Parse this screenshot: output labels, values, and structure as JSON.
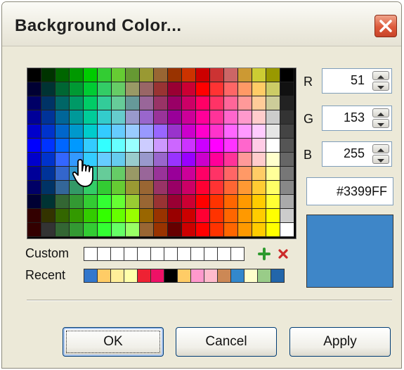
{
  "window": {
    "title": "Background Color...",
    "close_icon": "close-icon"
  },
  "palette": {
    "rows": [
      [
        "#000000",
        "#003300",
        "#006600",
        "#009900",
        "#00cc00",
        "#33cc33",
        "#66cc33",
        "#669933",
        "#999933",
        "#996633",
        "#993300",
        "#cc3300",
        "#cc0000",
        "#cc3333",
        "#cc6666",
        "#cc9933",
        "#cccc33",
        "#999900",
        "#000000"
      ],
      [
        "#000033",
        "#003333",
        "#006633",
        "#009933",
        "#00cc33",
        "#33cc66",
        "#66cc66",
        "#999966",
        "#996666",
        "#993333",
        "#990033",
        "#cc0033",
        "#ff0000",
        "#ff3333",
        "#ff6666",
        "#ff9966",
        "#ffcc66",
        "#cccc66",
        "#111111"
      ],
      [
        "#000066",
        "#003366",
        "#006666",
        "#009966",
        "#00cc66",
        "#33cc99",
        "#66cc99",
        "#669999",
        "#996699",
        "#993366",
        "#990066",
        "#cc0066",
        "#ff0066",
        "#ff3366",
        "#ff6699",
        "#ff9999",
        "#ffcc99",
        "#cccc99",
        "#222222"
      ],
      [
        "#000099",
        "#003399",
        "#006699",
        "#009999",
        "#00cc99",
        "#33cccc",
        "#66cccc",
        "#9999cc",
        "#9966cc",
        "#993399",
        "#990099",
        "#cc0099",
        "#ff0099",
        "#ff3399",
        "#ff66cc",
        "#ff99cc",
        "#ffcccc",
        "#cccccc",
        "#333333"
      ],
      [
        "#0000cc",
        "#0033cc",
        "#0066cc",
        "#0099cc",
        "#00cccc",
        "#33ccff",
        "#66ccff",
        "#99ccff",
        "#9999ff",
        "#9966ff",
        "#9933cc",
        "#cc00cc",
        "#ff00cc",
        "#ff33cc",
        "#ff66ff",
        "#ff99ff",
        "#ffccff",
        "#e6e6e6",
        "#444444"
      ],
      [
        "#0000ff",
        "#0033ff",
        "#0066ff",
        "#0099ff",
        "#33ccff",
        "#33ffff",
        "#66ffff",
        "#99ffff",
        "#ccccff",
        "#cc99ff",
        "#cc66ff",
        "#cc33ff",
        "#cc00ff",
        "#ff00ff",
        "#ff33ff",
        "#ff66cc",
        "#ffcce6",
        "#ffffff",
        "#555555"
      ],
      [
        "#0000cc",
        "#0033cc",
        "#3366ff",
        "#3399ff",
        "#33ccff",
        "#66ccff",
        "#66ccee",
        "#99cccc",
        "#9999cc",
        "#9966cc",
        "#9933ff",
        "#9900ff",
        "#cc00cc",
        "#ff0099",
        "#ff3399",
        "#ff9999",
        "#ffcccc",
        "#ffffcc",
        "#666666"
      ],
      [
        "#000099",
        "#003399",
        "#3366cc",
        "#3399cc",
        "#33cc99",
        "#66cc99",
        "#66cc66",
        "#999966",
        "#996699",
        "#993399",
        "#990099",
        "#cc0099",
        "#ff0066",
        "#ff3366",
        "#ff6666",
        "#ff9966",
        "#ffcc66",
        "#ffff99",
        "#777777"
      ],
      [
        "#000066",
        "#003366",
        "#336699",
        "#339966",
        "#33cc66",
        "#33cc33",
        "#66cc33",
        "#999933",
        "#996633",
        "#993366",
        "#990066",
        "#cc0066",
        "#ff0033",
        "#ff3333",
        "#ff6633",
        "#ff9933",
        "#ffcc33",
        "#ffff66",
        "#888888"
      ],
      [
        "#000033",
        "#003333",
        "#336633",
        "#339933",
        "#33cc33",
        "#33ff33",
        "#66ff33",
        "#99cc33",
        "#996633",
        "#993333",
        "#990033",
        "#cc0033",
        "#ff0000",
        "#ff3300",
        "#ff6600",
        "#ff9900",
        "#ffcc00",
        "#ffff33",
        "#aaaaaa"
      ],
      [
        "#330000",
        "#333300",
        "#336600",
        "#339900",
        "#33cc00",
        "#33ff00",
        "#66ff00",
        "#99ff00",
        "#996600",
        "#993300",
        "#990000",
        "#cc0000",
        "#ff0033",
        "#ff3300",
        "#ff6600",
        "#ff9900",
        "#ffcc00",
        "#ffff00",
        "#cccccc"
      ],
      [
        "#330000",
        "#333333",
        "#336633",
        "#339933",
        "#33cc33",
        "#33ff33",
        "#66ff66",
        "#99ff66",
        "#996633",
        "#993300",
        "#660000",
        "#cc0000",
        "#ff0000",
        "#ff3300",
        "#ff6600",
        "#ff9900",
        "#ffcc00",
        "#ffff00",
        "#ffffff"
      ]
    ]
  },
  "rgb": {
    "r_label": "R",
    "r_value": "51",
    "g_label": "G",
    "g_value": "153",
    "b_label": "B",
    "b_value": "255"
  },
  "hex": {
    "value": "#3399FF"
  },
  "preview": {
    "color": "#3e86c8"
  },
  "custom": {
    "label": "Custom",
    "slots": [
      "#ffffff",
      "#ffffff",
      "#ffffff",
      "#ffffff",
      "#ffffff",
      "#ffffff",
      "#ffffff",
      "#ffffff",
      "#ffffff",
      "#ffffff",
      "#ffffff",
      "#ffffff"
    ],
    "add_icon": "plus-icon",
    "delete_icon": "x-icon"
  },
  "recent": {
    "label": "Recent",
    "slots": [
      "#3377cc",
      "#ffcc66",
      "#ffee99",
      "#ffffaa",
      "#ee2233",
      "#ee1166",
      "#000000",
      "#ffcc66",
      "#ff99cc",
      "#ffbbcc",
      "#cc8855",
      "#3388cc",
      "#ffffcc",
      "#99cc88",
      "#2266aa"
    ]
  },
  "buttons": {
    "ok": "OK",
    "cancel": "Cancel",
    "apply": "Apply"
  }
}
